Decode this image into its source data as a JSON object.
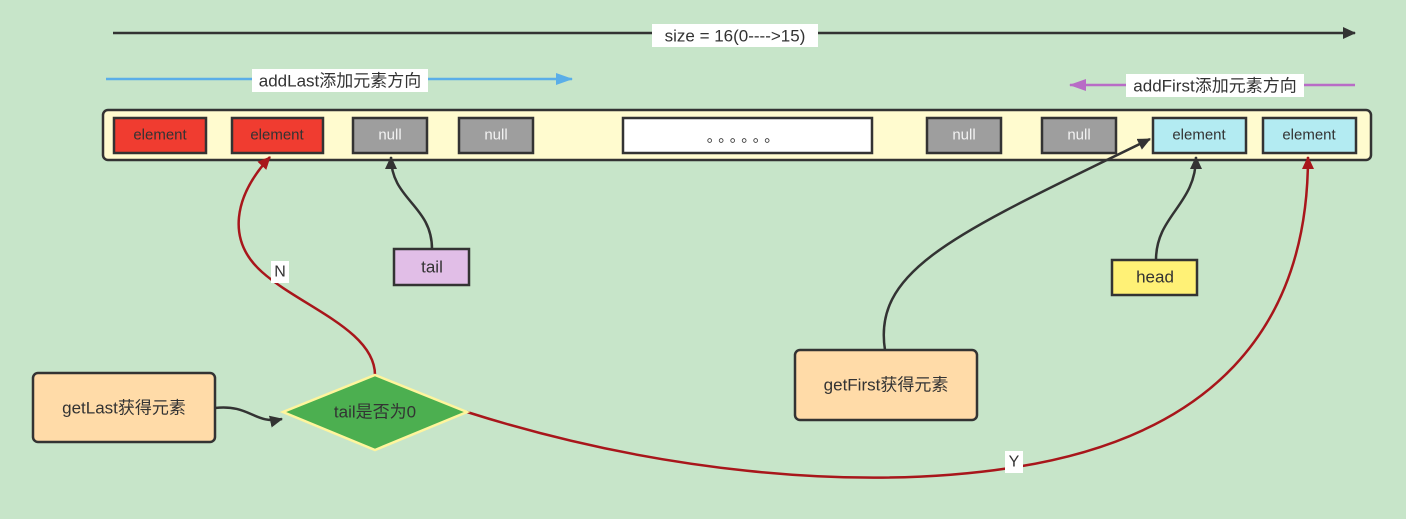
{
  "size_arrow": {
    "label": "size = 16(0---->15)",
    "color": "#333333"
  },
  "add_last": {
    "label": "addLast添加元素方向",
    "color": "#5aaee8"
  },
  "add_first": {
    "label": "addFirst添加元素方向",
    "color": "#b86cc6"
  },
  "array": {
    "fill": "#fffbcf",
    "cells": [
      {
        "text": "element",
        "color": "#f03c30"
      },
      {
        "text": "element",
        "color": "#f03c30"
      },
      {
        "text": "null",
        "color": "#9e9e9e"
      },
      {
        "text": "null",
        "color": "#9e9e9e"
      },
      {
        "text": "。。。。。。",
        "color": "#ffffff"
      },
      {
        "text": "null",
        "color": "#9e9e9e"
      },
      {
        "text": "null",
        "color": "#9e9e9e"
      },
      {
        "text": "element",
        "color": "#b3ebf2"
      },
      {
        "text": "element",
        "color": "#b3ebf2"
      }
    ]
  },
  "pointers": {
    "tail": {
      "label": "tail",
      "color": "#e1bee7"
    },
    "head": {
      "label": "head",
      "color": "#fff176"
    }
  },
  "nodes": {
    "get_last": {
      "label": "getLast获得元素",
      "color": "#ffdba8"
    },
    "condition": {
      "label": "tail是否为0",
      "color": "#4caf50"
    },
    "get_first": {
      "label": "getFirst获得元素",
      "color": "#ffdba8"
    }
  },
  "edges": {
    "no_label": "N",
    "yes_label": "Y",
    "branch_color": "#a8161b"
  }
}
